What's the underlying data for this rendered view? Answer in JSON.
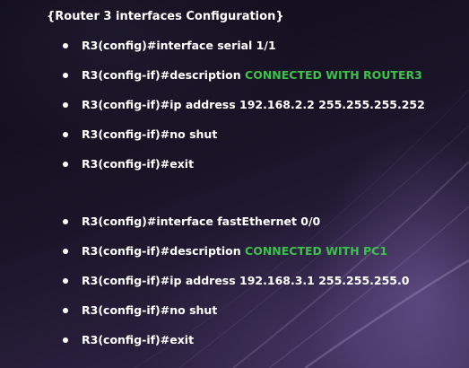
{
  "title": "{Router 3 interfaces Configuration}",
  "block1": {
    "line1": "R3(config)#interface serial 1/1",
    "line2_prefix": "R3(config-if)#description ",
    "line2_highlight": "CONNECTED WITH ROUTER3",
    "line3": "R3(config-if)#ip address 192.168.2.2 255.255.255.252",
    "line4": "R3(config-if)#no shut",
    "line5": "R3(config-if)#exit"
  },
  "block2": {
    "line1": "R3(config)#interface fastEthernet 0/0",
    "line2_prefix": "R3(config-if)#description ",
    "line2_highlight": "CONNECTED WITH PC1",
    "line3": "R3(config-if)#ip address 192.168.3.1 255.255.255.0",
    "line4": "R3(config-if)#no shut",
    "line5": "R3(config-if)#exit"
  },
  "colors": {
    "text": "#ffffff",
    "highlight": "#3cc24a",
    "background": "#1a1428"
  }
}
